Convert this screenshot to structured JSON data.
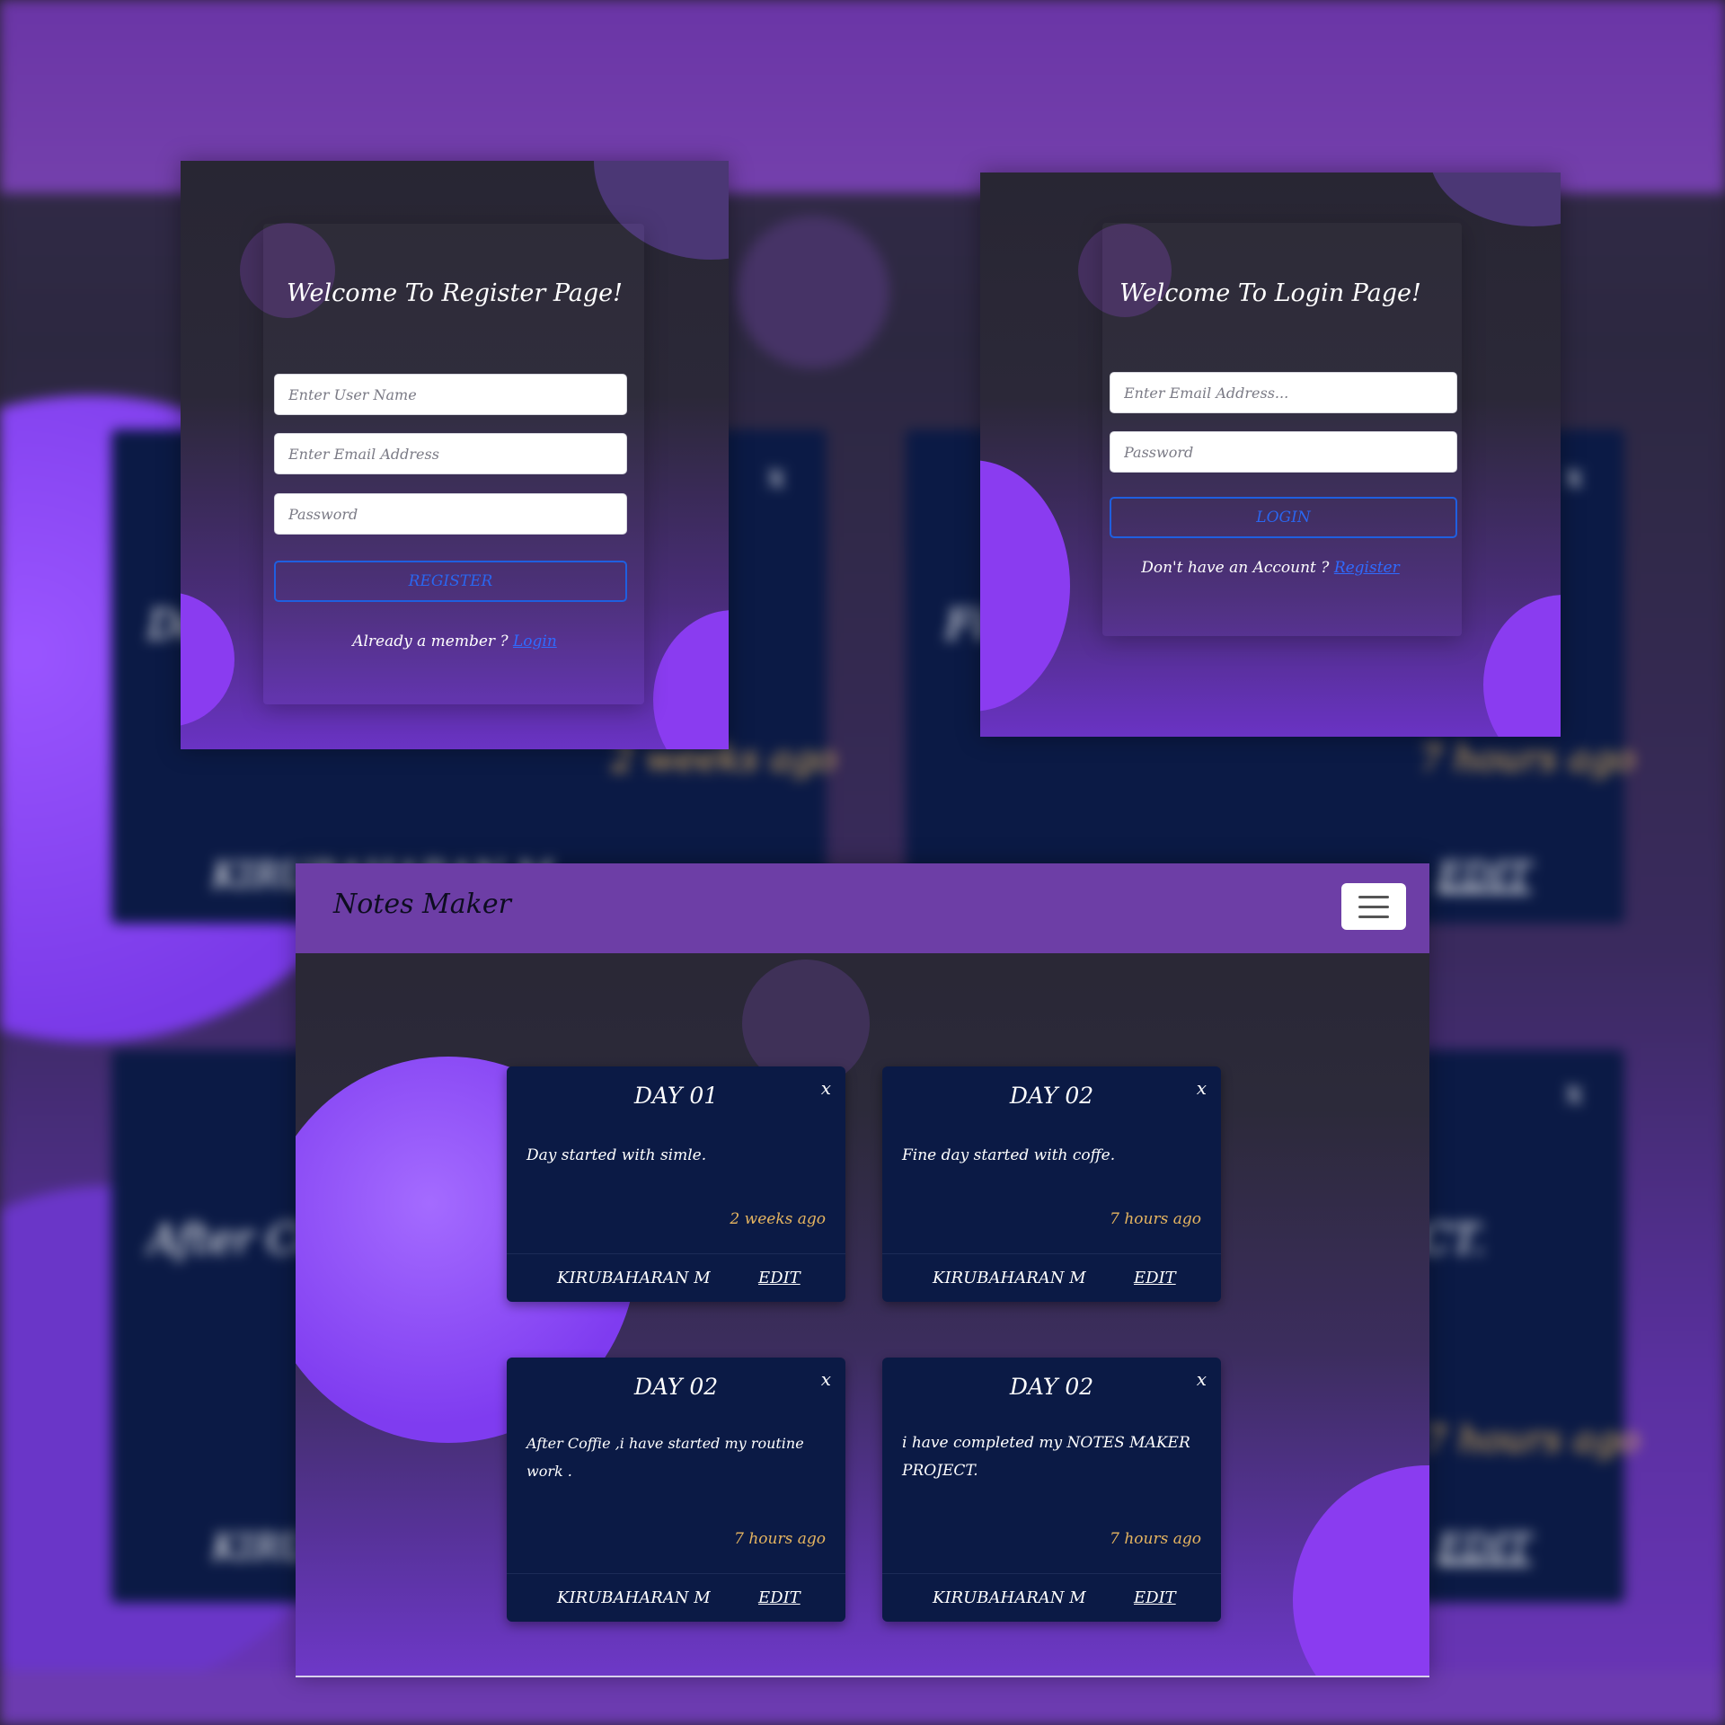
{
  "register_page": {
    "title": "Welcome To Register Page!",
    "username_placeholder": "Enter User Name",
    "email_placeholder": "Enter Email Address",
    "password_placeholder": "Password",
    "register_button": "REGISTER",
    "footer_text": "Already a member ?",
    "login_link": "Login"
  },
  "login_page": {
    "title": "Welcome To Login Page!",
    "email_placeholder": "Enter Email Address...",
    "password_placeholder": "Password",
    "login_button": "LOGIN",
    "footer_text": "Don't have an Account ?",
    "register_link": "Register"
  },
  "notes_page": {
    "brand": "Notes Maker",
    "menu_icon": "hamburger-icon",
    "notes": [
      {
        "title": "DAY 01",
        "body": "Day started with simle.",
        "time": "2 weeks ago",
        "author": "KIRUBAHARAN M",
        "edit": "EDIT",
        "close": "x"
      },
      {
        "title": "DAY 02",
        "body": "Fine day started with coffe.",
        "time": "7 hours ago",
        "author": "KIRUBAHARAN M",
        "edit": "EDIT",
        "close": "x"
      },
      {
        "title": "DAY 02",
        "body": "After Coffie ,i have started my routine work .",
        "time": "7 hours ago",
        "author": "KIRUBAHARAN M",
        "edit": "EDIT",
        "close": "x"
      },
      {
        "title": "DAY 02",
        "body": "i have completed my NOTES MAKER PROJECT.",
        "time": "7 hours ago",
        "author": "KIRUBAHARAN M",
        "edit": "EDIT",
        "close": "x"
      }
    ]
  },
  "colors": {
    "accent_purple": "#6d3ea6",
    "note_card": "#0b1a45",
    "timestamp": "#e6b560",
    "link_blue": "#2f6bff"
  }
}
